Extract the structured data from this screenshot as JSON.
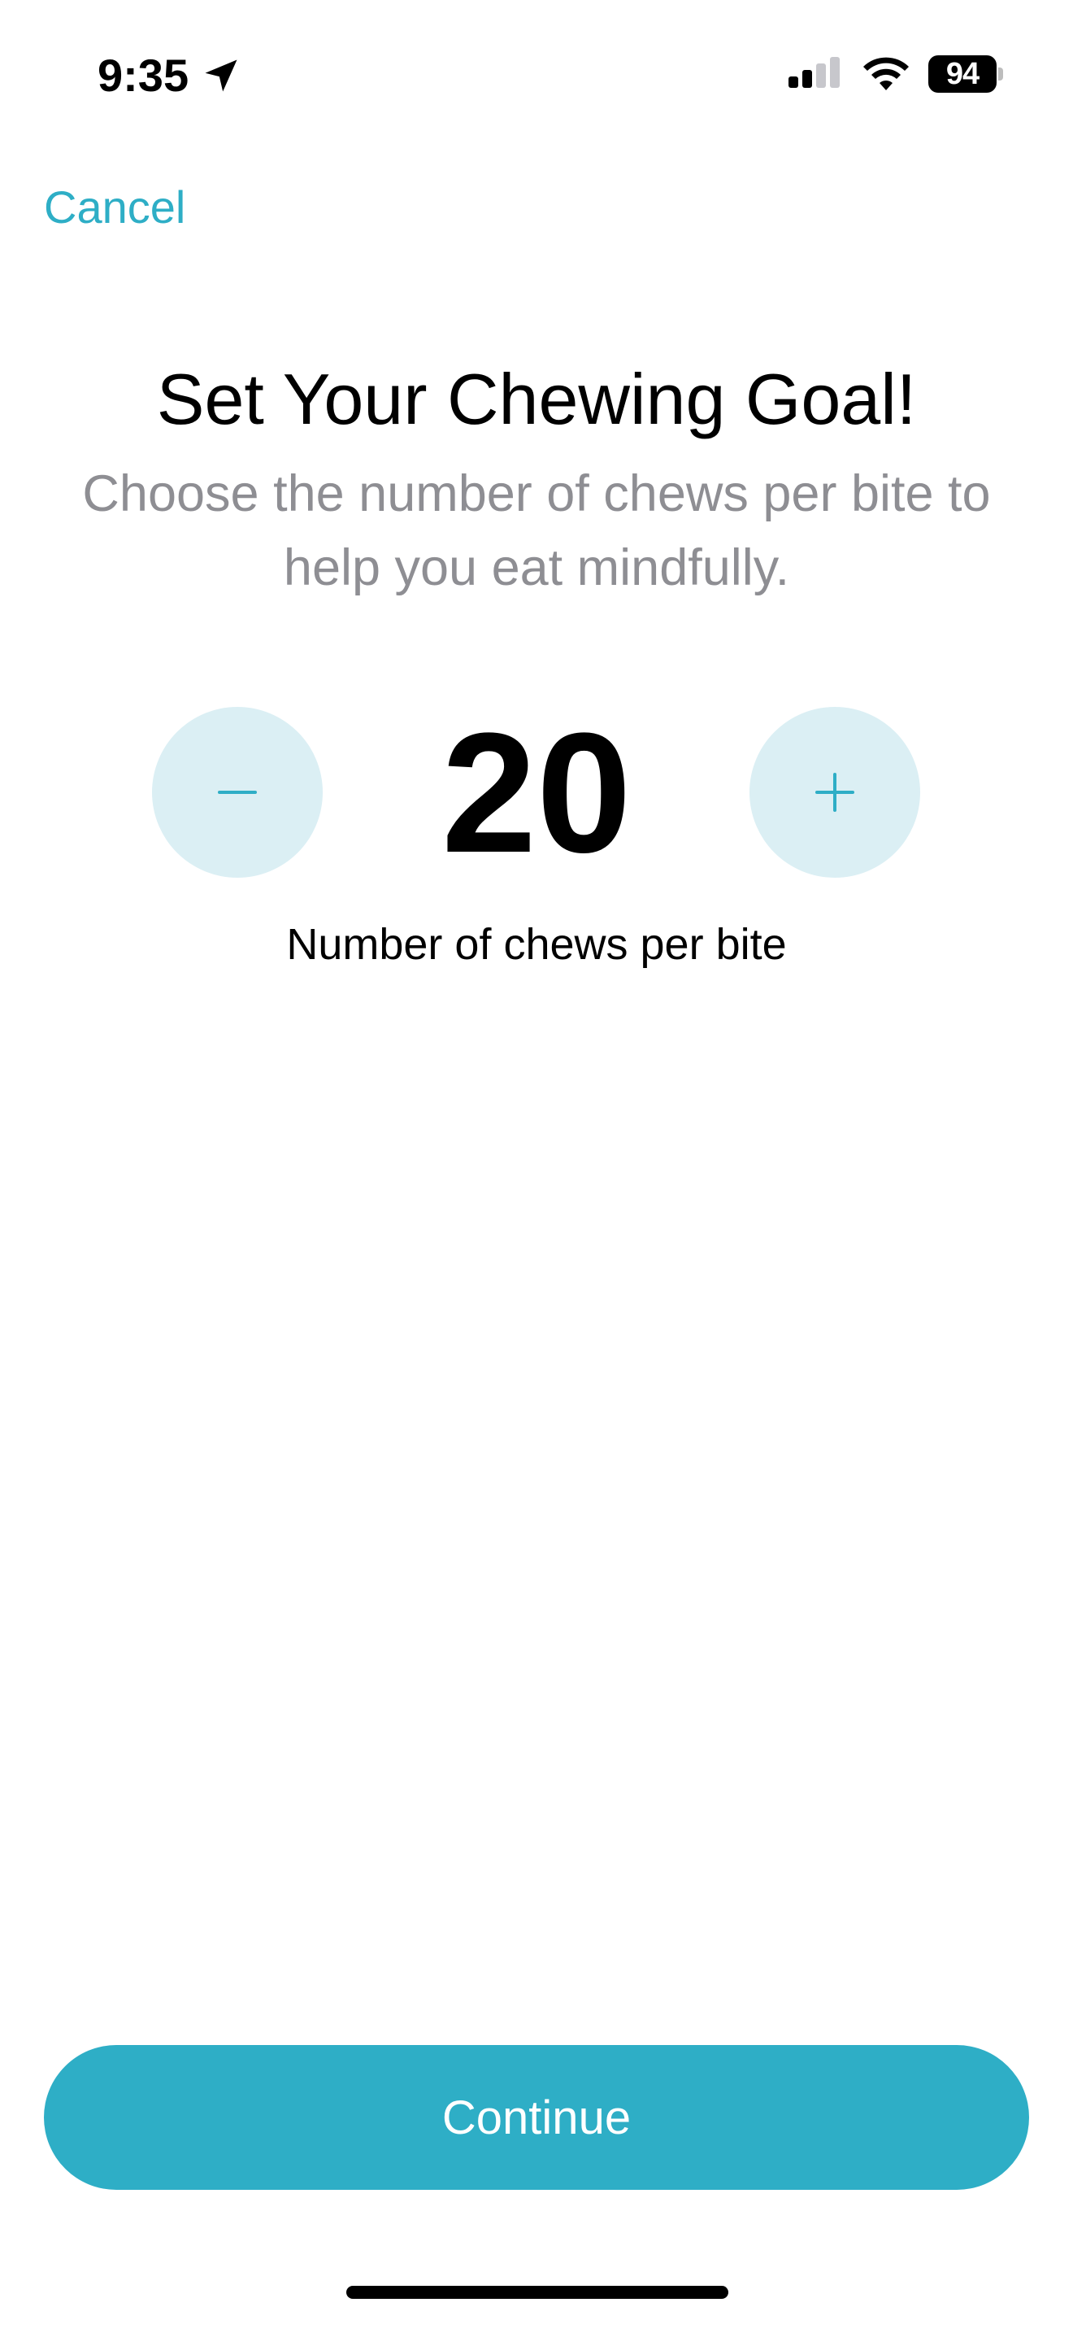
{
  "status_bar": {
    "time": "9:35",
    "battery": "94",
    "icons": [
      "location-arrow-icon",
      "cellular-signal-icon",
      "wifi-icon",
      "battery-icon"
    ]
  },
  "nav": {
    "cancel_label": "Cancel"
  },
  "header": {
    "title": "Set Your Chewing Goal!",
    "subtitle": "Choose the number of chews per bite to help you eat mindfully."
  },
  "stepper": {
    "value": "20",
    "label": "Number of chews per bite",
    "decrement_icon": "minus-icon",
    "increment_icon": "plus-icon"
  },
  "footer": {
    "continue_label": "Continue"
  },
  "colors": {
    "accent": "#2eaec6",
    "stepper_bg": "#dbeff4",
    "subtitle": "#8e8e93",
    "background": "#ffffff"
  }
}
